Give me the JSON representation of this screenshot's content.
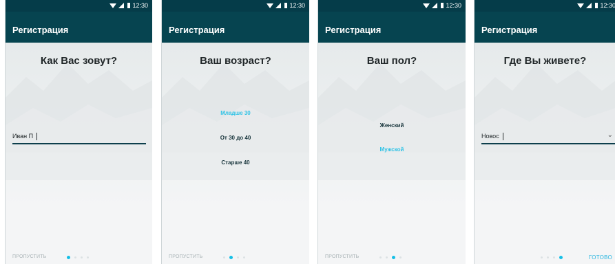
{
  "status_time": "12:30",
  "app_title": "Регистрация",
  "skip_label": "ПРОПУСТИТЬ",
  "done_label": "ГОТОВО",
  "screens": [
    {
      "question": "Как Вас зовут?",
      "input_value": "Иван П",
      "active_step": 1
    },
    {
      "question": "Ваш возраст?",
      "options": [
        "Младше 30",
        "От 30 до 40",
        "Старше 40"
      ],
      "selected": "Младше 30",
      "active_step": 2
    },
    {
      "question": "Ваш пол?",
      "options": [
        "Женский",
        "Мужской"
      ],
      "selected": "Мужской",
      "active_step": 3
    },
    {
      "question": "Где Вы живете?",
      "input_value": "Новос",
      "active_step": 4
    }
  ],
  "colors": {
    "status_bar": "#053c49",
    "app_bar": "#064450",
    "accent": "#31c3e6"
  }
}
